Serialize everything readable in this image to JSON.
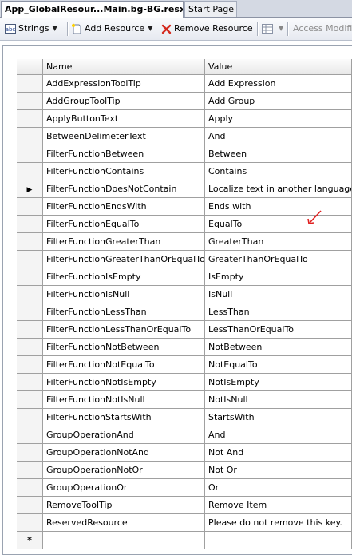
{
  "tabs": {
    "active_label": "App_GlobalResour...Main.bg-BG.resx*",
    "inactive_label": "Start Page"
  },
  "toolbar": {
    "strings_label": "Strings",
    "add_resource_label": "Add Resource",
    "remove_resource_label": "Remove Resource",
    "access_modifier_label": "Access Modifi"
  },
  "grid": {
    "columns": [
      "Name",
      "Value"
    ],
    "rows": [
      {
        "name": "AddExpressionToolTip",
        "value": "Add Expression"
      },
      {
        "name": "AddGroupToolTip",
        "value": "Add Group"
      },
      {
        "name": "ApplyButtonText",
        "value": "Apply"
      },
      {
        "name": "BetweenDelimeterText",
        "value": "And"
      },
      {
        "name": "FilterFunctionBetween",
        "value": "Between"
      },
      {
        "name": "FilterFunctionContains",
        "value": "Contains"
      },
      {
        "name": "FilterFunctionDoesNotContain",
        "value": "Localize text in another language"
      },
      {
        "name": "FilterFunctionEndsWith",
        "value": "Ends with"
      },
      {
        "name": "FilterFunctionEqualTo",
        "value": "EqualTo"
      },
      {
        "name": "FilterFunctionGreaterThan",
        "value": "GreaterThan"
      },
      {
        "name": "FilterFunctionGreaterThanOrEqualTo",
        "value": "GreaterThanOrEqualTo"
      },
      {
        "name": "FilterFunctionIsEmpty",
        "value": "IsEmpty"
      },
      {
        "name": "FilterFunctionIsNull",
        "value": "IsNull"
      },
      {
        "name": "FilterFunctionLessThan",
        "value": "LessThan"
      },
      {
        "name": "FilterFunctionLessThanOrEqualTo",
        "value": "LessThanOrEqualTo"
      },
      {
        "name": "FilterFunctionNotBetween",
        "value": "NotBetween"
      },
      {
        "name": "FilterFunctionNotEqualTo",
        "value": "NotEqualTo"
      },
      {
        "name": "FilterFunctionNotIsEmpty",
        "value": "NotIsEmpty"
      },
      {
        "name": "FilterFunctionNotIsNull",
        "value": "NotIsNull"
      },
      {
        "name": "FilterFunctionStartsWith",
        "value": "StartsWith"
      },
      {
        "name": "GroupOperationAnd",
        "value": "And"
      },
      {
        "name": "GroupOperationNotAnd",
        "value": "Not And"
      },
      {
        "name": "GroupOperationNotOr",
        "value": "Not Or"
      },
      {
        "name": "GroupOperationOr",
        "value": "Or"
      },
      {
        "name": "RemoveToolTip",
        "value": "Remove Item"
      },
      {
        "name": "ReservedResource",
        "value": "Please do not remove this key."
      }
    ],
    "current_row_marker": "▶",
    "new_row_marker": "*",
    "current_row_index": 6
  },
  "colors": {
    "annotation_arrow": "#e02020",
    "remove_icon": "#d42a1e"
  }
}
